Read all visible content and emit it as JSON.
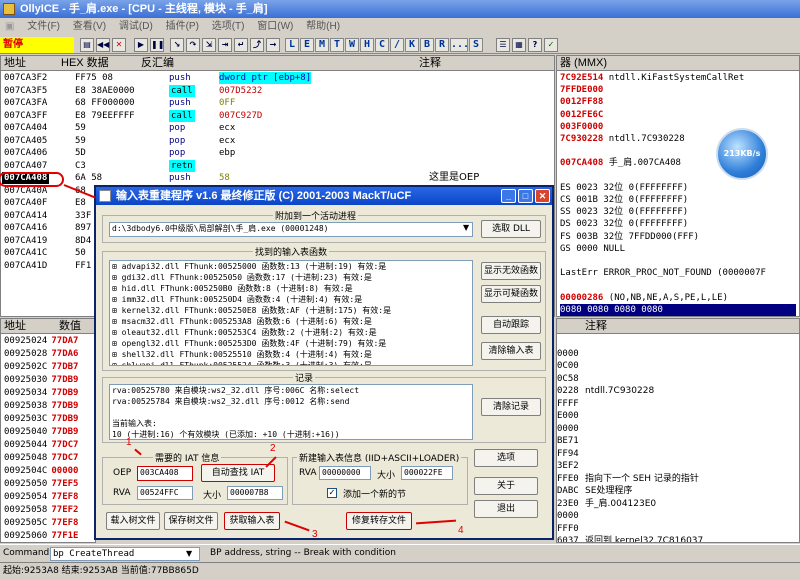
{
  "app": {
    "title": "OllyICE - 手_肩.exe - [CPU - 主线程, 模块 - 手_肩]"
  },
  "menu": [
    "文件(F)",
    "查看(V)",
    "调试(D)",
    "插件(P)",
    "选项(T)",
    "窗口(W)",
    "帮助(H)"
  ],
  "toolbar": {
    "status": "暂停",
    "letters": [
      "L",
      "E",
      "M",
      "T",
      "W",
      "H",
      "C",
      "/",
      "K",
      "B",
      "R",
      "...",
      "S"
    ]
  },
  "disasm": {
    "headers": [
      "地址",
      "HEX 数据",
      "反汇编",
      "注释"
    ],
    "rows": [
      {
        "addr": "007CA3F2",
        "hex": "FF75 08",
        "op": "push",
        "arg": "dword ptr [ebp+8]",
        "cmt": ""
      },
      {
        "addr": "007CA3F5",
        "hex": "E8 38AE0000",
        "op": "call",
        "arg": "007D5232",
        "cmt": ""
      },
      {
        "addr": "007CA3FA",
        "hex": "68 FF000000",
        "op": "push",
        "arg": "0FF",
        "cmt": ""
      },
      {
        "addr": "007CA3FF",
        "hex": "E8 79EEFFFF",
        "op": "call",
        "arg": "007C927D",
        "cmt": ""
      },
      {
        "addr": "007CA404",
        "hex": "59",
        "op": "pop",
        "arg": "ecx",
        "cmt": ""
      },
      {
        "addr": "007CA405",
        "hex": "59",
        "op": "pop",
        "arg": "ecx",
        "cmt": ""
      },
      {
        "addr": "007CA406",
        "hex": "5D",
        "op": "pop",
        "arg": "ebp",
        "cmt": ""
      },
      {
        "addr": "007CA407",
        "hex": "C3",
        "op": "retn",
        "arg": "",
        "cmt": ""
      },
      {
        "addr": "007CA408",
        "hex": "6A 58",
        "op": "push",
        "arg": "58",
        "cmt": "这里是OEP"
      },
      {
        "addr": "007CA40A",
        "hex": "68",
        "op": "",
        "arg": "",
        "cmt": ""
      },
      {
        "addr": "007CA40F",
        "hex": "E8",
        "op": "",
        "arg": "",
        "cmt": ""
      },
      {
        "addr": "007CA414",
        "hex": "33F",
        "op": "",
        "arg": "",
        "cmt": ""
      },
      {
        "addr": "007CA416",
        "hex": "897",
        "op": "",
        "arg": "",
        "cmt": ""
      },
      {
        "addr": "007CA419",
        "hex": "8D4",
        "op": "",
        "arg": "",
        "cmt": ""
      },
      {
        "addr": "007CA41C",
        "hex": "50",
        "op": "",
        "arg": "",
        "cmt": ""
      },
      {
        "addr": "007CA41D",
        "hex": "FF1",
        "op": "",
        "arg": "",
        "cmt": ""
      }
    ]
  },
  "registers": {
    "header": "器 (MMX)",
    "lines": [
      {
        "v": "7C92E514",
        "t": " ntdll.KiFastSystemCallRet",
        "red": true
      },
      {
        "v": "7FFDE000",
        "t": "",
        "red": true
      },
      {
        "v": "0012FF88",
        "t": "",
        "red": true
      },
      {
        "v": "0012FE6C",
        "t": "",
        "red": true
      },
      {
        "v": "003F0000",
        "t": "",
        "red": true
      },
      {
        "v": "7C930228",
        "t": " ntdll.7C930228",
        "red": true
      },
      {
        "v": "",
        "t": "",
        "red": false
      },
      {
        "v": "007CA408",
        "t": " 手_肩.007CA408",
        "red": true
      },
      {
        "v": "",
        "t": "",
        "red": false
      },
      {
        "v": "ES 0023 32位 0(FFFFFFFF)",
        "t": "",
        "red": false
      },
      {
        "v": "CS 001B 32位 0(FFFFFFFF)",
        "t": "",
        "red": false
      },
      {
        "v": "SS 0023 32位 0(FFFFFFFF)",
        "t": "",
        "red": false
      },
      {
        "v": "DS 0023 32位 0(FFFFFFFF)",
        "t": "",
        "red": false
      },
      {
        "v": "FS 003B 32位 7FFDD000(FFF)",
        "t": "",
        "red": false
      },
      {
        "v": "GS 0000 NULL",
        "t": "",
        "red": false
      },
      {
        "v": "",
        "t": "",
        "red": false
      },
      {
        "v": "LastErr ERROR_PROC_NOT_FOUND (0000007F",
        "t": "",
        "red": false
      },
      {
        "v": "",
        "t": "",
        "red": false
      },
      {
        "v": "00000286",
        "t": " (NO,NB,NE,A,S,PE,L,LE)",
        "red": true
      }
    ],
    "mmx": [
      "0080 0080 0080 0080",
      "0000 0080 0080 0080"
    ]
  },
  "speed": "213KB/s",
  "dump": {
    "headers": [
      "地址",
      "数值"
    ],
    "rows": [
      [
        "00925024",
        "77DA7"
      ],
      [
        "00925028",
        "77DA6"
      ],
      [
        "0092502C",
        "77DB7"
      ],
      [
        "00925030",
        "77DB9"
      ],
      [
        "00925034",
        "77DB9"
      ],
      [
        "00925038",
        "77DB9"
      ],
      [
        "0092503C",
        "77DB9"
      ],
      [
        "00925040",
        "77DB9"
      ],
      [
        "00925044",
        "77DC7"
      ],
      [
        "00925048",
        "77DC7"
      ],
      [
        "0092504C",
        "00000"
      ],
      [
        "00925050",
        "77EF5"
      ],
      [
        "00925054",
        "77EF8"
      ],
      [
        "00925058",
        "77EF2"
      ],
      [
        "0092505C",
        "77EF8"
      ],
      [
        "00925060",
        "77F1E"
      ]
    ]
  },
  "stack": {
    "header": "注释",
    "rows": [
      {
        "v": "",
        "c": ""
      },
      {
        "v": "0000",
        "c": ""
      },
      {
        "v": "0C00",
        "c": ""
      },
      {
        "v": "0C58",
        "c": ""
      },
      {
        "v": "0228",
        "c": "ntdll.7C930228"
      },
      {
        "v": "FFFF",
        "c": ""
      },
      {
        "v": "E000",
        "c": ""
      },
      {
        "v": "0000",
        "c": ""
      },
      {
        "v": "BE71",
        "c": ""
      },
      {
        "v": "FF94",
        "c": ""
      },
      {
        "v": "3EF2",
        "c": ""
      },
      {
        "v": "FFE0",
        "c": "指向下一个 SEH 记录的指针"
      },
      {
        "v": "DABC",
        "c": "SE处理程序"
      },
      {
        "v": "23E0",
        "c": "手_肩.004123E0"
      },
      {
        "v": "0000",
        "c": ""
      },
      {
        "v": "FFF0",
        "c": ""
      },
      {
        "v": "6037",
        "c": "返回到 kernel32.7C816037"
      },
      {
        "v": "",
        "c": "ntdll.7C930228"
      }
    ]
  },
  "importrec": {
    "title": "输入表重建程序 v1.6 最终修正版 (C) 2001-2003 MackT/uCF",
    "attach_label": "附加到一个活动进程",
    "process": "d:\\3dbody6.0中级版\\局部解剖\\手_肩.exe (00001248)",
    "select_dll": "选取 DLL",
    "found_label": "找到的输入表函数",
    "imports": [
      "advapi32.dll FThunk:00525000 函数数:13 (十进制:19) 有效:是",
      "gdi32.dll FThunk:00525050 函数数:17 (十进制:23) 有效:是",
      "hid.dll FThunk:005250B0 函数数:8 (十进制:8) 有效:是",
      "imm32.dll FThunk:005250D4 函数数:4 (十进制:4) 有效:是",
      "kernel32.dll FThunk:005250E8 函数数:AF (十进制:175) 有效:是",
      "msacm32.dll FThunk:005253A8 函数数:6 (十进制:6) 有效:是",
      "oleaut32.dll FThunk:005253C4 函数数:2 (十进制:2) 有效:是",
      "opengl32.dll FThunk:005253D0 函数数:4F (十进制:79) 有效:是",
      "shell32.dll FThunk:00525510 函数数:4 (十进制:4) 有效:是",
      "shlwapi.dll FThunk:00525524 函数数:3 (十进制:3) 有效:是"
    ],
    "side_buttons": [
      "显示无效函数",
      "显示可疑函数",
      "自动跟踪",
      "清除输入表"
    ],
    "log_label": "记录",
    "log": [
      "rva:00525780 来自模块:ws2_32.dll 序号:006C 名称:select",
      "rva:00525784 来自模块:ws2_32.dll 序号:0012 名称:send",
      "",
      "当前输入表:",
      "10 (十进制:16) 个有效模块 (已添加: +10 (十进制:+16))",
      "11D (十进制:477) 个输入函数. (已添加: +11D (十进制:+477))"
    ],
    "clear_log": "清除记录",
    "iat_label": "需要的 IAT 信息",
    "oep_label": "OEP",
    "oep_value": "003CA408",
    "auto_find": "自动查找 IAT",
    "rva_label": "RVA",
    "rva_value": "00524FFC",
    "size_label": "大小",
    "size_value": "000007B8",
    "newimp_label": "新建输入表信息 (IID+ASCII+LOADER)",
    "new_rva": "00000000",
    "new_size": "000022FE",
    "add_section": "添加一个新的节",
    "options": "选项",
    "about": "关于",
    "exit": "退出",
    "load_tree": "载入树文件",
    "save_tree": "保存树文件",
    "get_imports": "获取输入表",
    "fix_dump": "修复转存文件",
    "markers": [
      "1",
      "2",
      "3",
      "4"
    ]
  },
  "command": {
    "label": "Command",
    "value": "bp CreateThread",
    "hint": "BP address, string -- Break with condition"
  },
  "status": "起始:9253A8 结束:9253AB 当前值:77BB865D"
}
